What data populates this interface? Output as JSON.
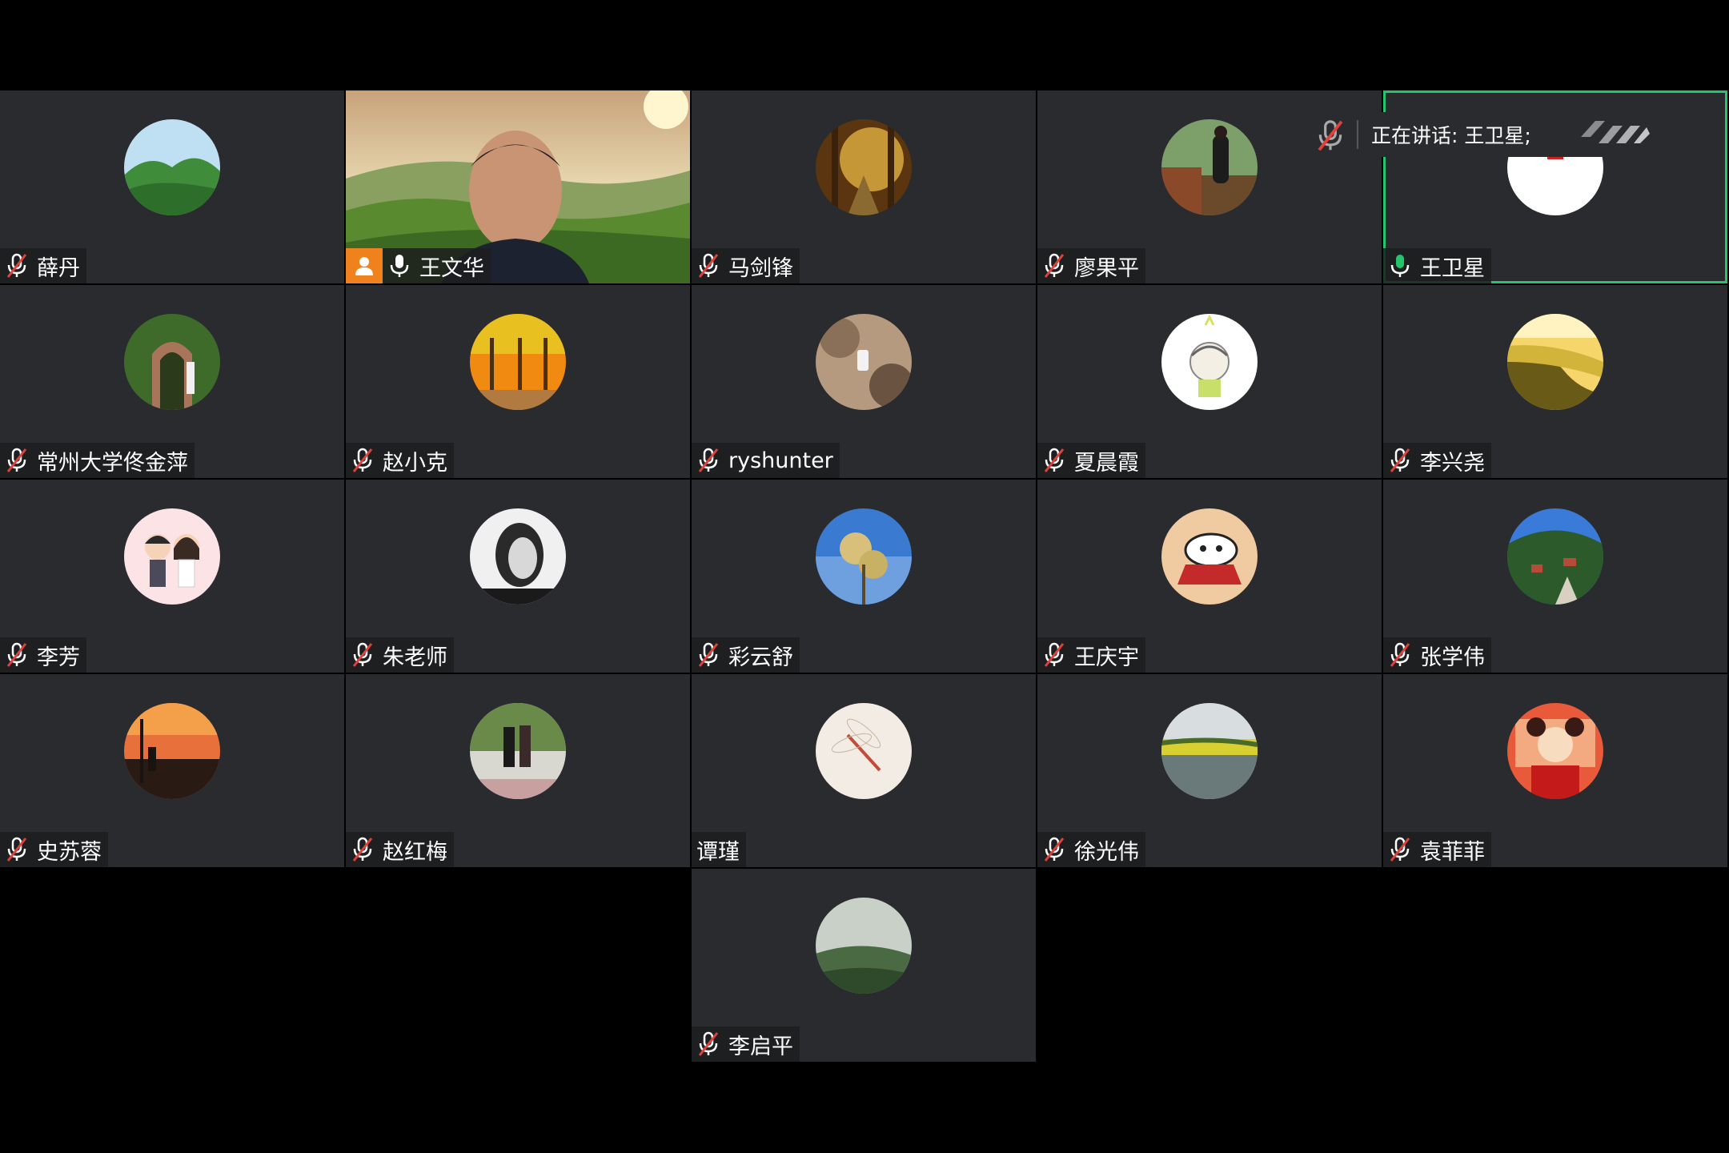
{
  "active_speaker": {
    "label": "正在讲话: 王卫星;"
  },
  "colors": {
    "tile_bg": "#2a2b2e",
    "speaking_border": "#23c56b",
    "host_badge": "#f0821e",
    "mic_muted": "#e0413a",
    "mic_active": "#23c56b"
  },
  "participants": [
    {
      "name": "薛丹",
      "mic": "muted",
      "avatar": "green-mountain"
    },
    {
      "name": "王文华",
      "mic": "on",
      "host": true,
      "video": "camera-on"
    },
    {
      "name": "马剑锋",
      "mic": "muted",
      "avatar": "autumn-forest"
    },
    {
      "name": "廖果平",
      "mic": "muted",
      "avatar": "lakeside-walk"
    },
    {
      "name": "王卫星",
      "mic": "on",
      "speaking": true,
      "avatar": "red-cartoon"
    },
    {
      "name": "常州大学佟金萍",
      "mic": "muted",
      "avatar": "garden-arch"
    },
    {
      "name": "赵小克",
      "mic": "muted",
      "avatar": "orange-trees"
    },
    {
      "name": "ryshunter",
      "mic": "muted",
      "avatar": "rocky-car"
    },
    {
      "name": "夏晨霞",
      "mic": "muted",
      "avatar": "cartoon-girl"
    },
    {
      "name": "李兴尧",
      "mic": "muted",
      "avatar": "river-sunset"
    },
    {
      "name": "李芳",
      "mic": "muted",
      "avatar": "cartoon-couple"
    },
    {
      "name": "朱老师",
      "mic": "muted",
      "avatar": "bw-portrait"
    },
    {
      "name": "彩云舒",
      "mic": "muted",
      "avatar": "blossom-sky"
    },
    {
      "name": "王庆宇",
      "mic": "muted",
      "avatar": "cartoon-dog"
    },
    {
      "name": "张学伟",
      "mic": "muted",
      "avatar": "mountain-village"
    },
    {
      "name": "史苏蓉",
      "mic": "muted",
      "avatar": "sunset-silhouette"
    },
    {
      "name": "赵红梅",
      "mic": "muted",
      "avatar": "couple-outdoors"
    },
    {
      "name": "谭瑾",
      "mic": "none",
      "avatar": "dragonfly"
    },
    {
      "name": "徐光伟",
      "mic": "muted",
      "avatar": "yellow-fields"
    },
    {
      "name": "袁菲菲",
      "mic": "muted",
      "avatar": "red-cartoon-girl"
    },
    {
      "name": "李启平",
      "mic": "muted",
      "avatar": "misty-hills"
    }
  ]
}
